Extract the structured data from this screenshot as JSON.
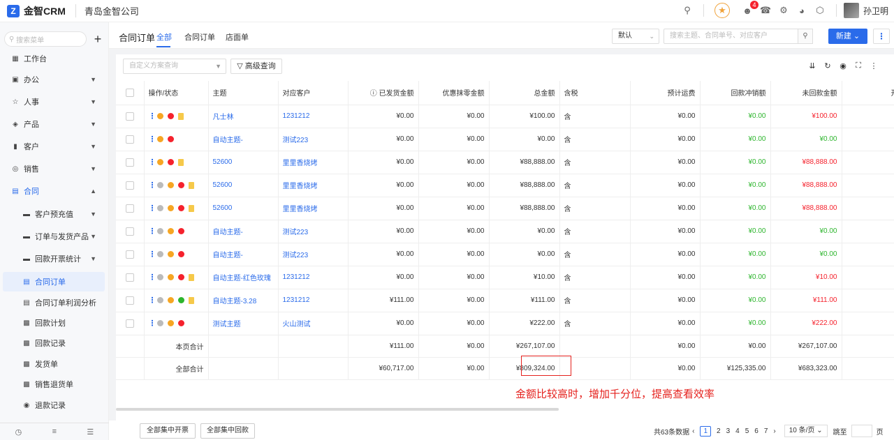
{
  "header": {
    "app_name": "金智CRM",
    "company": "青岛金智公司",
    "notification_count": "4",
    "user_name": "孙卫明"
  },
  "sidebar": {
    "search_placeholder": "搜索菜单",
    "items": [
      {
        "label": "工作台",
        "icon": "dashboard-icon"
      },
      {
        "label": "办公",
        "icon": "office-icon"
      },
      {
        "label": "人事",
        "icon": "people-icon"
      },
      {
        "label": "产品",
        "icon": "product-icon"
      },
      {
        "label": "客户",
        "icon": "customer-icon"
      },
      {
        "label": "销售",
        "icon": "sales-icon"
      },
      {
        "label": "合同",
        "icon": "contract-icon"
      },
      {
        "label": "客户预充值",
        "icon": "folder-icon"
      },
      {
        "label": "订单与发货产品",
        "icon": "folder-icon"
      },
      {
        "label": "回款开票统计",
        "icon": "folder-icon"
      },
      {
        "label": "合同订单",
        "icon": "document-icon"
      },
      {
        "label": "合同订单利润分析",
        "icon": "document-icon"
      },
      {
        "label": "回款计划",
        "icon": "calendar-icon"
      },
      {
        "label": "回款记录",
        "icon": "calendar-icon"
      },
      {
        "label": "发货单",
        "icon": "calendar-icon"
      },
      {
        "label": "销售退货单",
        "icon": "calendar-icon"
      },
      {
        "label": "退款记录",
        "icon": "refund-icon"
      }
    ]
  },
  "page": {
    "title": "合同订单",
    "tabs": [
      "全部",
      "合同订单",
      "店面单"
    ],
    "view_select": "默认",
    "search_placeholder": "搜索主题、合同单号、对应客户",
    "new_button": "新建",
    "filter_placeholder": "自定义方案查询",
    "advanced_button": "高级查询"
  },
  "table": {
    "headers": [
      "操作/状态",
      "主题",
      "对应客户",
      "已发货金额",
      "优惠抹零金额",
      "总金额",
      "含税",
      "预计运费",
      "回款冲销额",
      "未回款金额",
      "开票金"
    ],
    "rows": [
      {
        "ops": [
          "play",
          "alert",
          "doc"
        ],
        "subject": "凡士林",
        "customer": "1231212",
        "shipped": "¥0.00",
        "discount": "¥0.00",
        "total": "¥100.00",
        "tax": "含",
        "freight": "¥0.00",
        "writeoff": "¥0.00",
        "unpaid": "¥100.00",
        "unpaid_red": true
      },
      {
        "ops": [
          "play",
          "x"
        ],
        "subject": "自动主题-",
        "customer": "测试223",
        "shipped": "¥0.00",
        "discount": "¥0.00",
        "total": "¥0.00",
        "tax": "含",
        "freight": "¥0.00",
        "writeoff": "¥0.00",
        "unpaid": "¥0.00",
        "unpaid_red": false
      },
      {
        "ops": [
          "play",
          "alert",
          "doc"
        ],
        "subject": "52600",
        "customer": "里里香烧烤",
        "shipped": "¥0.00",
        "discount": "¥0.00",
        "total": "¥88,888.00",
        "tax": "含",
        "freight": "¥0.00",
        "writeoff": "¥0.00",
        "unpaid": "¥88,888.00",
        "unpaid_red": true
      },
      {
        "ops": [
          "user",
          "play",
          "alert",
          "doc"
        ],
        "subject": "52600",
        "customer": "里里香烧烤",
        "shipped": "¥0.00",
        "discount": "¥0.00",
        "total": "¥88,888.00",
        "tax": "含",
        "freight": "¥0.00",
        "writeoff": "¥0.00",
        "unpaid": "¥88,888.00",
        "unpaid_red": true
      },
      {
        "ops": [
          "user",
          "play",
          "alert",
          "doc"
        ],
        "subject": "52600",
        "customer": "里里香烧烤",
        "shipped": "¥0.00",
        "discount": "¥0.00",
        "total": "¥88,888.00",
        "tax": "含",
        "freight": "¥0.00",
        "writeoff": "¥0.00",
        "unpaid": "¥88,888.00",
        "unpaid_red": true
      },
      {
        "ops": [
          "user",
          "play",
          "x"
        ],
        "subject": "自动主题-",
        "customer": "测试223",
        "shipped": "¥0.00",
        "discount": "¥0.00",
        "total": "¥0.00",
        "tax": "含",
        "freight": "¥0.00",
        "writeoff": "¥0.00",
        "unpaid": "¥0.00",
        "unpaid_red": false
      },
      {
        "ops": [
          "user",
          "play",
          "x"
        ],
        "subject": "自动主题-",
        "customer": "测试223",
        "shipped": "¥0.00",
        "discount": "¥0.00",
        "total": "¥0.00",
        "tax": "含",
        "freight": "¥0.00",
        "writeoff": "¥0.00",
        "unpaid": "¥0.00",
        "unpaid_red": false
      },
      {
        "ops": [
          "user",
          "play",
          "alert",
          "doc"
        ],
        "subject": "自动主题-红色玫瑰",
        "customer": "1231212",
        "shipped": "¥0.00",
        "discount": "¥0.00",
        "total": "¥10.00",
        "tax": "含",
        "freight": "¥0.00",
        "writeoff": "¥0.00",
        "unpaid": "¥10.00",
        "unpaid_red": true
      },
      {
        "ops": [
          "user",
          "play",
          "ok",
          "doc"
        ],
        "subject": "自动主题-3.28",
        "customer": "1231212",
        "shipped": "¥111.00",
        "discount": "¥0.00",
        "total": "¥111.00",
        "tax": "含",
        "freight": "¥0.00",
        "writeoff": "¥0.00",
        "unpaid": "¥111.00",
        "unpaid_red": true
      },
      {
        "ops": [
          "user",
          "play",
          "x"
        ],
        "subject": "测试主题",
        "customer": "火山测试",
        "shipped": "¥0.00",
        "discount": "¥0.00",
        "total": "¥222.00",
        "tax": "含",
        "freight": "¥0.00",
        "writeoff": "¥0.00",
        "unpaid": "¥222.00",
        "unpaid_red": true
      }
    ],
    "page_total": {
      "label": "本页合计",
      "shipped": "¥111.00",
      "discount": "¥0.00",
      "total": "¥267,107.00",
      "freight": "¥0.00",
      "writeoff": "¥0.00",
      "unpaid": "¥267,107.00"
    },
    "all_total": {
      "label": "全部合计",
      "shipped": "¥60,717.00",
      "discount": "¥0.00",
      "total": "¥809,324.00",
      "freight": "¥0.00",
      "writeoff": "¥125,335.00",
      "unpaid": "¥683,323.00"
    }
  },
  "annotation": "金额比较高时，增加千分位，提高查看效率",
  "footer": {
    "batch_invoice": "全部集中开票",
    "batch_payment": "全部集中回款",
    "total_count": "共63条数据",
    "pages": [
      "1",
      "2",
      "3",
      "4",
      "5",
      "6",
      "7"
    ],
    "page_size": "10 条/页",
    "jump_label": "跳至",
    "page_unit": "页"
  },
  "colors": {
    "accent": "#2a6bea",
    "positive": "#2db52d",
    "negative": "#f5222d",
    "annotation": "#e5211d"
  }
}
